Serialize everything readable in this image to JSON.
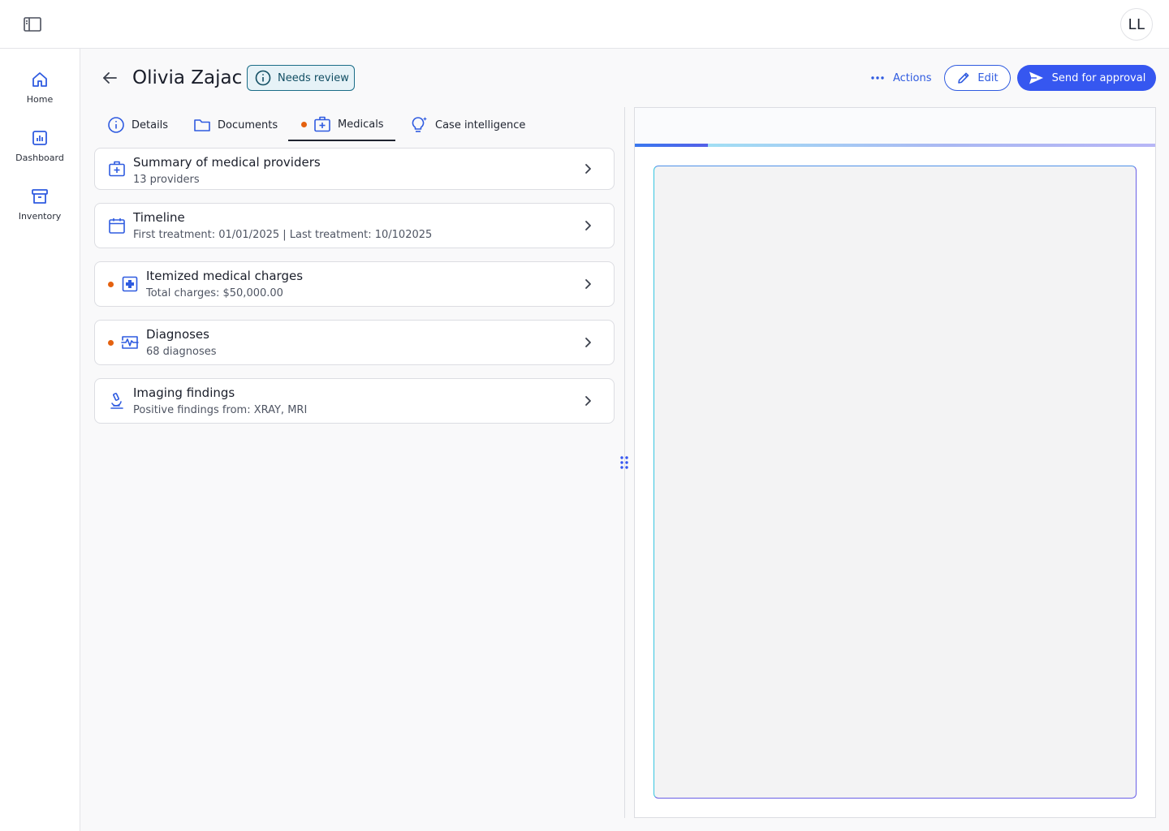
{
  "user": {
    "initials": "LL"
  },
  "nav": [
    {
      "label": "Home",
      "icon": "home-icon"
    },
    {
      "label": "Dashboard",
      "icon": "chart-icon"
    },
    {
      "label": "Inventory",
      "icon": "archive-icon"
    }
  ],
  "header": {
    "title": "Olivia Zajac",
    "status": "Needs review",
    "actions_label": "Actions",
    "edit_label": "Edit",
    "send_label": "Send for approval"
  },
  "tabs": [
    {
      "label": "Details",
      "icon": "info-icon",
      "flagged": false
    },
    {
      "label": "Documents",
      "icon": "folder-icon",
      "flagged": false
    },
    {
      "label": "Medicals",
      "icon": "medical-kit-icon",
      "flagged": true,
      "active": true
    },
    {
      "label": "Case intelligence",
      "icon": "lightbulb-sparkle-icon",
      "flagged": false
    }
  ],
  "cards": [
    {
      "title": "Summary of medical providers",
      "subtitle": "13 providers",
      "icon": "medical-kit-icon",
      "flagged": false
    },
    {
      "title": "Timeline",
      "subtitle": "First treatment: 01/01/2025 | Last treatment: 10/102025",
      "icon": "calendar-icon",
      "flagged": false
    },
    {
      "title": "Itemized medical charges",
      "subtitle": "Total charges: $50,000.00",
      "icon": "medical-plus-icon",
      "flagged": true
    },
    {
      "title": "Diagnoses",
      "subtitle": "68 diagnoses",
      "icon": "pulse-monitor-icon",
      "flagged": true
    },
    {
      "title": "Imaging findings",
      "subtitle": "Positive findings from: XRAY, MRI",
      "icon": "microscope-icon",
      "flagged": false
    }
  ],
  "preview": {
    "progress": 0.14
  },
  "colors": {
    "accent": "#3657f0",
    "flag": "#e4610f",
    "badge_border": "#1b6d87"
  }
}
